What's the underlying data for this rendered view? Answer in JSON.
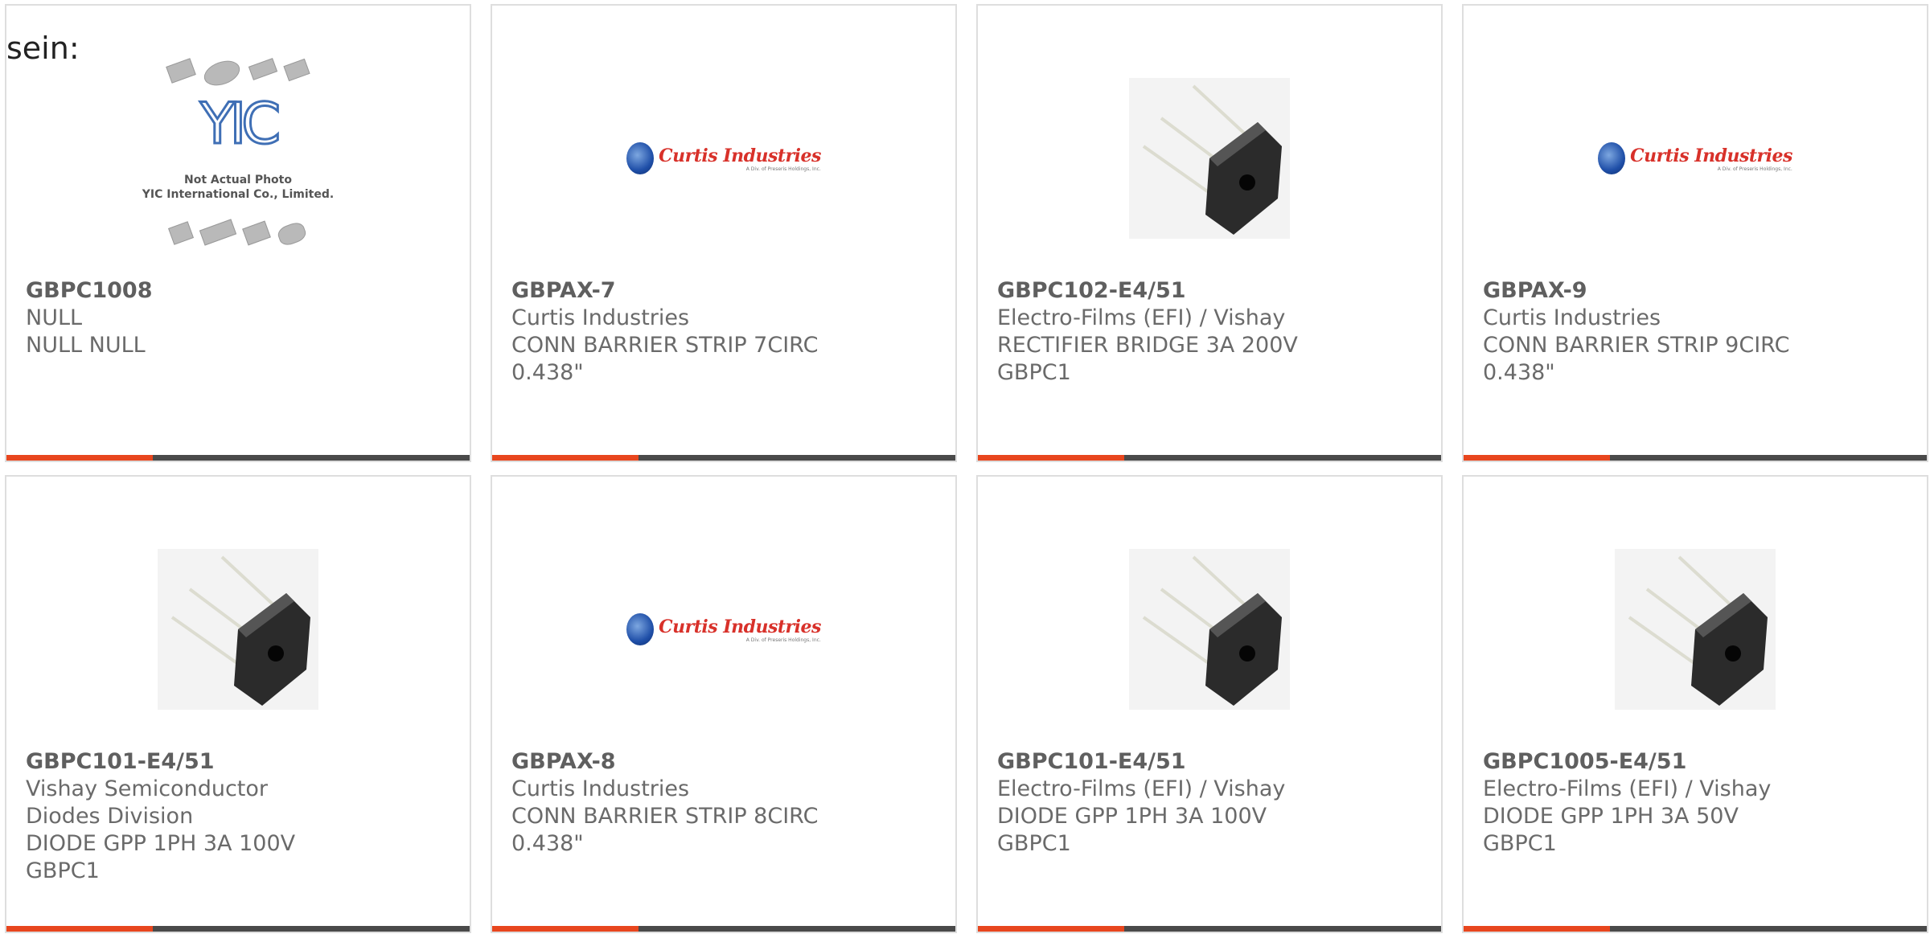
{
  "heading": "sein:",
  "cards": [
    {
      "part": "GBPC1008",
      "manufacturer": "NULL",
      "description": "NULL NULL",
      "image": "yic-placeholder"
    },
    {
      "part": "GBPAX-7",
      "manufacturer": "Curtis Industries",
      "description": "CONN BARRIER STRIP 7CIRC 0.438\"",
      "image": "curtis-logo"
    },
    {
      "part": "GBPC102-E4/51",
      "manufacturer": "Electro-Films (EFI) / Vishay",
      "description": "RECTIFIER BRIDGE 3A 200V GBPC1",
      "image": "bridge-rectifier"
    },
    {
      "part": "GBPAX-9",
      "manufacturer": "Curtis Industries",
      "description": "CONN BARRIER STRIP 9CIRC 0.438\"",
      "image": "curtis-logo"
    },
    {
      "part": "GBPC101-E4/51",
      "manufacturer": "Vishay Semiconductor Diodes Division",
      "description": "DIODE GPP 1PH 3A 100V GBPC1",
      "image": "bridge-rectifier"
    },
    {
      "part": "GBPAX-8",
      "manufacturer": "Curtis Industries",
      "description": "CONN BARRIER STRIP 8CIRC 0.438\"",
      "image": "curtis-logo"
    },
    {
      "part": "GBPC101-E4/51",
      "manufacturer": "Electro-Films (EFI) / Vishay",
      "description": "DIODE GPP 1PH 3A 100V GBPC1",
      "image": "bridge-rectifier"
    },
    {
      "part": "GBPC1005-E4/51",
      "manufacturer": "Electro-Films (EFI) / Vishay",
      "description": "DIODE GPP 1PH 3A 50V GBPC1",
      "image": "bridge-rectifier"
    }
  ],
  "logos": {
    "curtis_name": "Curtis Industries",
    "curtis_sub": "A Div. of Preseris Holdings, Inc.",
    "yic_mark": "YIC",
    "yic_note_1": "Not Actual Photo",
    "yic_note_2": "YIC International Co., Limited."
  },
  "colors": {
    "accent": "#e8461e",
    "bar": "#4a4a4a",
    "border": "#dedede"
  }
}
